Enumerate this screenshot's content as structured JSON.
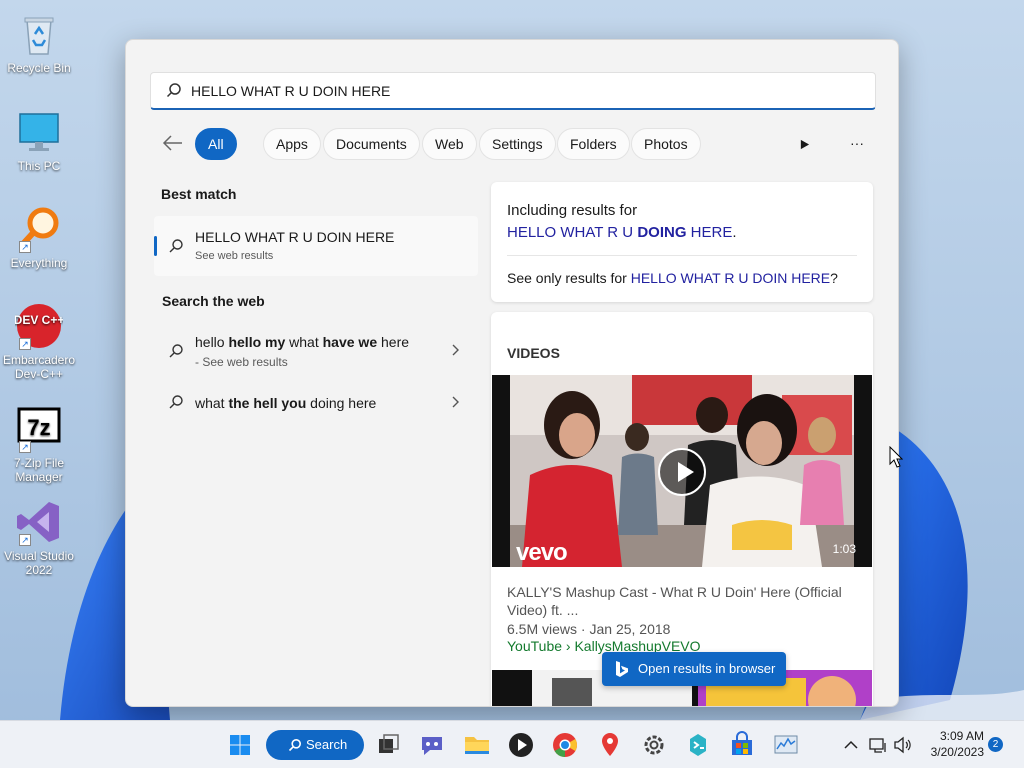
{
  "desktop": {
    "icons": [
      {
        "label": "Recycle Bin",
        "icon": "recycle-bin-icon"
      },
      {
        "label": "This PC",
        "icon": "monitor-icon"
      },
      {
        "label": "Everything",
        "icon": "magnifier-icon"
      },
      {
        "label": "Embarcadero Dev-C++",
        "icon": "devcpp-icon",
        "logo_text": "DEV C++"
      },
      {
        "label": "7-Zip File Manager",
        "icon": "7zip-icon",
        "logo_text": "7z"
      },
      {
        "label": "Visual Studio 2022",
        "icon": "visual-studio-icon"
      }
    ]
  },
  "search": {
    "query": "HELLO WHAT R U DOIN HERE",
    "filters": [
      "All",
      "Apps",
      "Documents",
      "Web",
      "Settings",
      "Folders",
      "Photos"
    ],
    "active_filter": "All",
    "best_match": {
      "heading": "Best match",
      "title": "HELLO WHAT R U DOIN HERE",
      "subtitle": "See web results"
    },
    "web": {
      "heading": "Search the web",
      "items": [
        {
          "parts": [
            [
              "hello ",
              false
            ],
            [
              "hello my",
              true
            ],
            [
              " what ",
              false
            ],
            [
              "have we",
              true
            ],
            [
              " here",
              false
            ]
          ],
          "subtitle": "- See web results"
        },
        {
          "parts": [
            [
              "what ",
              false
            ],
            [
              "the hell you",
              true
            ],
            [
              " doing here",
              false
            ]
          ],
          "subtitle": ""
        }
      ]
    },
    "spell": {
      "including": "Including results for",
      "corrected_before": "HELLO WHAT R U ",
      "corrected_bold": "DOING",
      "corrected_after": " HERE",
      "period": ".",
      "only_prefix": "See only results for ",
      "only_link": "HELLO WHAT R U DOIN HERE",
      "only_suffix": "?"
    },
    "videos": {
      "heading": "VIDEOS",
      "watermark": "vevo",
      "duration": "1:03",
      "title": "KALLY'S Mashup Cast - What R U Doin' Here (Official Video) ft. ...",
      "views": "6.5M views",
      "dot": "·",
      "date": "Jan 25, 2018",
      "source": "YouTube › KallysMashupVEVO"
    },
    "open_browser": "Open results in browser"
  },
  "taskbar": {
    "search_label": "Search",
    "time": "3:09 AM",
    "date": "3/20/2023",
    "notifications": "2"
  },
  "colors": {
    "accent": "#1067c4",
    "link": "#2222a0",
    "source_green": "#147a2e"
  }
}
